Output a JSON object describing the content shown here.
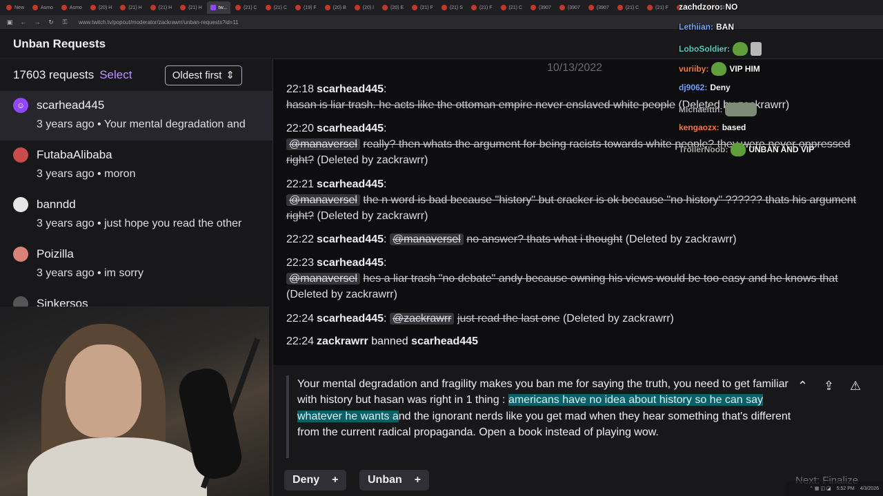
{
  "browser": {
    "tabs": [
      {
        "label": "New"
      },
      {
        "label": "Asmo"
      },
      {
        "label": "Asmo"
      },
      {
        "label": "(20) H"
      },
      {
        "label": "(21) H"
      },
      {
        "label": "(21) H"
      },
      {
        "label": "(21) H"
      },
      {
        "label": "tw..."
      },
      {
        "label": "(21) C"
      },
      {
        "label": "(21) C"
      },
      {
        "label": "(19) F"
      },
      {
        "label": "(20) B"
      },
      {
        "label": "(20) I"
      },
      {
        "label": "(20) E"
      },
      {
        "label": "(21) F"
      },
      {
        "label": "(21) S"
      },
      {
        "label": "(21) F"
      },
      {
        "label": "(21) C"
      },
      {
        "label": "(3907"
      },
      {
        "label": "(3907"
      },
      {
        "label": "(3907"
      },
      {
        "label": "(21) C"
      },
      {
        "label": "(21) F"
      },
      {
        "label": "(21) C"
      },
      {
        "label": "(3907"
      }
    ],
    "url": "www.twitch.tv/popout/moderator/zackrawrr/unban-requests?id=11"
  },
  "header": {
    "title": "Unban Requests"
  },
  "sidebar": {
    "count_label": "17603 requests",
    "select_label": "Select",
    "sort_label": "Oldest first",
    "items": [
      {
        "name": "scarhead445",
        "age": "3 years ago",
        "preview": "Your mental degradation and"
      },
      {
        "name": "FutabaAlibaba",
        "age": "3 years ago",
        "preview": "moron"
      },
      {
        "name": "banndd",
        "age": "3 years ago",
        "preview": "just hope you read the other"
      },
      {
        "name": "Poizilla",
        "age": "3 years ago",
        "preview": "im sorry"
      },
      {
        "name": "Sinkersos",
        "age": "",
        "preview": ""
      }
    ]
  },
  "chat_log": {
    "date": "10/13/2022",
    "messages": [
      {
        "time": "22:18",
        "user": "scarhead445",
        "mention": "",
        "text": "hasan is liar trash. he acts like the ottoman empire never enslaved white people",
        "deleted": "(Deleted by zackrawrr)"
      },
      {
        "time": "22:20",
        "user": "scarhead445",
        "mention": "@manaversel",
        "text": "really? then whats the argument for being racists towards white people? they were never oppressed right?",
        "deleted": "(Deleted by zackrawrr)"
      },
      {
        "time": "22:21",
        "user": "scarhead445",
        "mention": "@manaversel",
        "text": "the n word is bad because \"history\" but cracker is ok because \"no history\" ?????? thats his argument right?",
        "deleted": "(Deleted by zackrawrr)"
      },
      {
        "time": "22:22",
        "user": "scarhead445",
        "mention": "@manaversel",
        "text": "no answer? thats what i thought",
        "deleted": "(Deleted by zackrawrr)"
      },
      {
        "time": "22:23",
        "user": "scarhead445",
        "mention": "@manaversel",
        "text": "hes a liar trash \"no debate\" andy because owning his views would be too easy and he knows that",
        "deleted": "(Deleted by zackrawrr)"
      },
      {
        "time": "22:24",
        "user": "scarhead445",
        "mention": "@zackrawrr",
        "text": "just read the last one",
        "deleted": "(Deleted by zackrawrr)"
      }
    ],
    "ban_event": {
      "time": "22:24",
      "moderator": "zackrawrr",
      "action": "banned",
      "target": "scarhead445"
    }
  },
  "overlay_chat": [
    {
      "user": "zachdzoro:",
      "text": "NO",
      "color": "#ffffff"
    },
    {
      "user": "Lethiian:",
      "text": "BAN",
      "color": "#6fa8ff"
    },
    {
      "user": "LoboSoldier:",
      "text": "",
      "color": "#4fd4c4"
    },
    {
      "user": "vuriiby:",
      "text": "VIP HIM",
      "color": "#ff7a3d"
    },
    {
      "user": "dj9062:",
      "text": "Deny",
      "color": "#6fa8ff"
    },
    {
      "user": "Michaeltth:",
      "text": "",
      "color": "#b0b0b0"
    },
    {
      "user": "kengaozx:",
      "text": "based",
      "color": "#ff7a3d"
    },
    {
      "user": "TrollerNoob:",
      "text": "UNBAN AND VIP",
      "color": "#b0b0b0"
    }
  ],
  "detail": {
    "text_before": "Your mental degradation and fragility makes you ban me for saying the truth, you need to get familiar with history but hasan was right in 1 thing : ",
    "highlight": "americans have no idea about history so he can say whatever he wants a",
    "text_after": "nd the ignorant nerds like you get mad when they hear something that's different from the current radical propaganda. Open a book instead of playing wow."
  },
  "actions": {
    "deny_label": "Deny",
    "unban_label": "Unban",
    "next_label": "Next: Finalize"
  },
  "taskbar": {
    "time": "5:52 PM",
    "date": "4/3/2026"
  },
  "colors": {
    "accent": "#bf94ff",
    "highlight_bg": "#0b5f68",
    "avatar_purple": "#9147ff"
  }
}
